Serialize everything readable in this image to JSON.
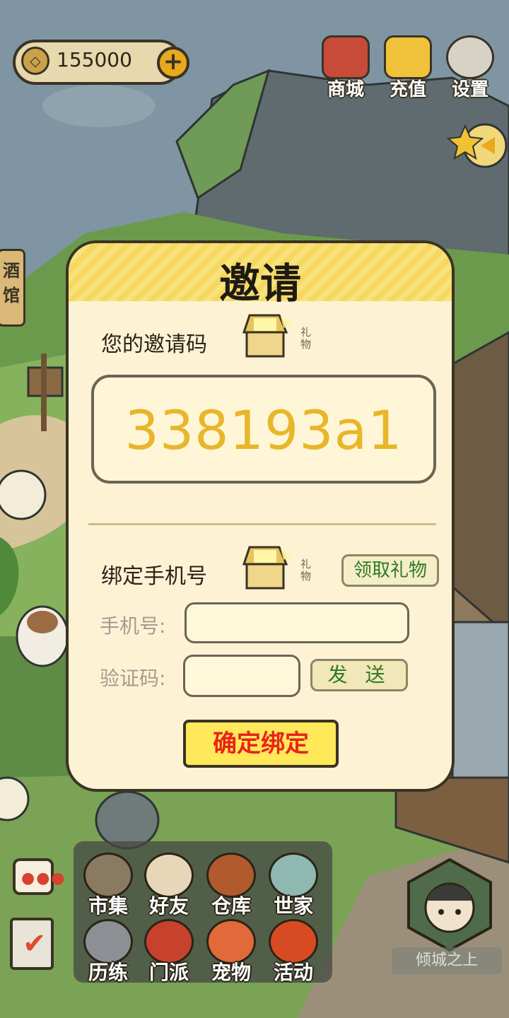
{
  "currency": {
    "value": "155000",
    "icon": "coin-icon",
    "add_icon": "plus-icon"
  },
  "top_buttons": [
    {
      "label": "商城",
      "icon": "shop-bag-icon"
    },
    {
      "label": "充值",
      "icon": "gold-ingot-icon"
    },
    {
      "label": "设置",
      "icon": "gear-icon"
    }
  ],
  "side_left": {
    "tavern_label": "酒馆"
  },
  "modal": {
    "title": "邀请",
    "invite_label": "您的邀请码",
    "gift_caption": "礼物",
    "invite_code": "338193a1",
    "bind_label": "绑定手机号",
    "claim_button": "领取礼物",
    "phone_label": "手机号:",
    "phone_value": "",
    "code_label": "验证码:",
    "code_value": "",
    "send_button": "发 送",
    "confirm_button": "确定绑定"
  },
  "menu": [
    {
      "label": "市集",
      "icon": "market-icon"
    },
    {
      "label": "好友",
      "icon": "handshake-icon"
    },
    {
      "label": "仓库",
      "icon": "warehouse-chest-icon"
    },
    {
      "label": "世家",
      "icon": "clan-armor-icon"
    },
    {
      "label": "历练",
      "icon": "crossed-swords-icon"
    },
    {
      "label": "门派",
      "icon": "sect-banner-icon"
    },
    {
      "label": "宠物",
      "icon": "paw-icon"
    },
    {
      "label": "活动",
      "icon": "lantern-icon"
    }
  ],
  "server_name": "倾城之上",
  "colors": {
    "accent_yellow": "#ffe85a",
    "code_gold": "#e8b62a",
    "confirm_red": "#e8231a",
    "green_text": "#2f7a25"
  }
}
